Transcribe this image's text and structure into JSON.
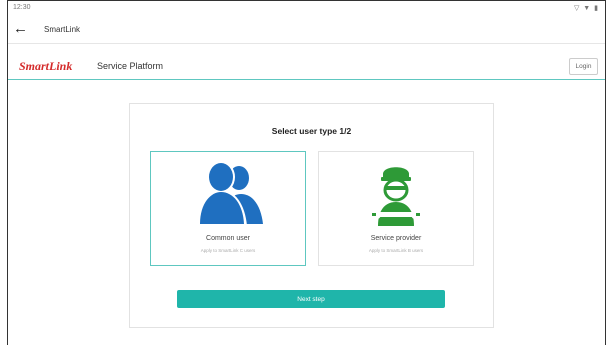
{
  "statusbar": {
    "time": "12:30",
    "indicators": "▽ ▼ ▮"
  },
  "appbar": {
    "back_icon": "←",
    "title": "SmartLink"
  },
  "header": {
    "brand": "SmartLink",
    "subtitle": "Service Platform",
    "login_label": "Login"
  },
  "selection": {
    "title": "Select user type 1/2",
    "options": [
      {
        "label": "Common user",
        "sub": "Apply to SmartLink C users",
        "icon": "users-icon",
        "selected": true
      },
      {
        "label": "Service provider",
        "sub": "Apply to SmartLink B users",
        "icon": "mechanic-icon",
        "selected": false
      }
    ],
    "next_label": "Next step"
  },
  "colors": {
    "accent": "#1fb5aa",
    "brand": "#d42a2a",
    "users_icon": "#1f6fc0",
    "mechanic_icon": "#2e9a37"
  }
}
